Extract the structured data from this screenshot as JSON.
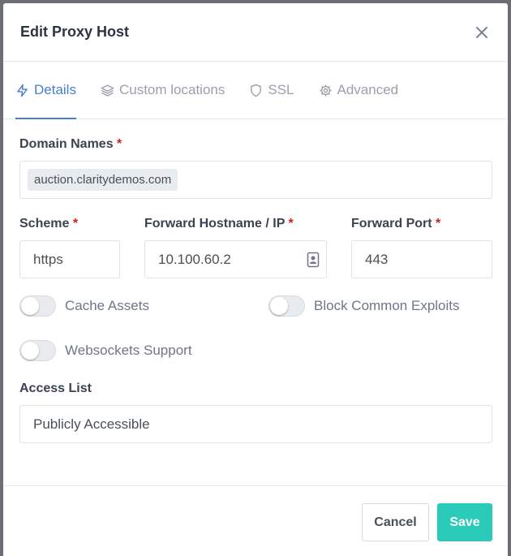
{
  "modal": {
    "title": "Edit Proxy Host"
  },
  "tabs": [
    {
      "label": "Details",
      "icon": "bolt-icon",
      "active": true
    },
    {
      "label": "Custom locations",
      "icon": "layers-icon",
      "active": false
    },
    {
      "label": "SSL",
      "icon": "shield-icon",
      "active": false
    },
    {
      "label": "Advanced",
      "icon": "gear-icon",
      "active": false
    }
  ],
  "form": {
    "domain_names": {
      "label": "Domain Names",
      "required_mark": "*",
      "tags": [
        "auction.claritydemos.com"
      ]
    },
    "scheme": {
      "label": "Scheme",
      "required_mark": "*",
      "value": "https"
    },
    "forward_host": {
      "label": "Forward Hostname / IP",
      "required_mark": "*",
      "value": "10.100.60.2"
    },
    "forward_port": {
      "label": "Forward Port",
      "required_mark": "*",
      "value": "443"
    },
    "toggles": {
      "cache_assets": {
        "label": "Cache Assets",
        "on": false
      },
      "block_exploits": {
        "label": "Block Common Exploits",
        "on": false
      },
      "websockets": {
        "label": "Websockets Support",
        "on": false
      }
    },
    "access_list": {
      "label": "Access List",
      "value": "Publicly Accessible"
    }
  },
  "footer": {
    "cancel_label": "Cancel",
    "save_label": "Save"
  },
  "colors": {
    "accent": "#467fcf",
    "save": "#2bcbba",
    "required": "#cd201f"
  }
}
